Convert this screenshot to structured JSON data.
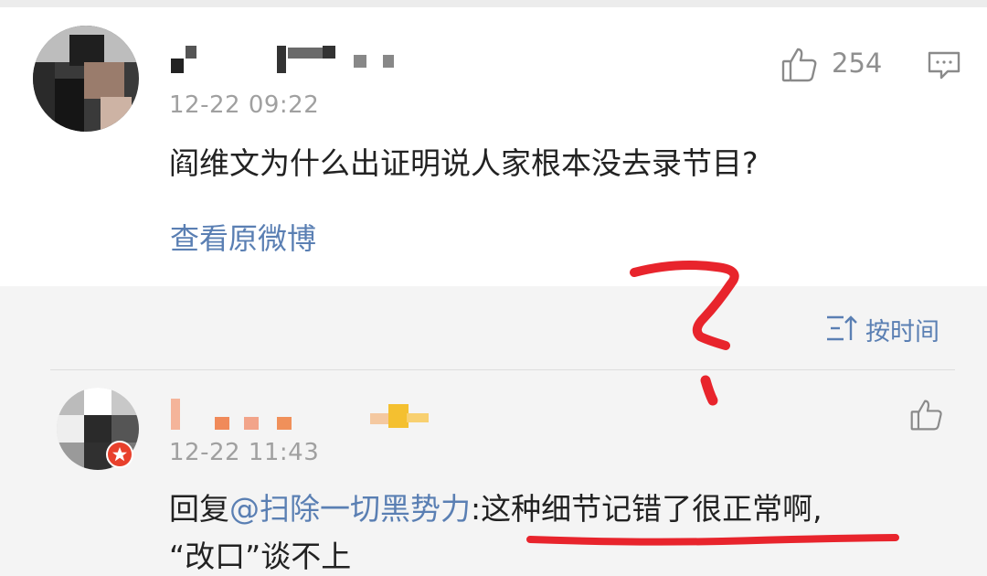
{
  "post": {
    "time": "12-22 09:22",
    "like_count": "254",
    "content": "阎维文为什么出证明说人家根本没去录节目?",
    "view_original_link": "查看原微博",
    "like_icon": "thumbs-up-icon",
    "comment_icon": "comment-bubble-icon"
  },
  "comments_header": {
    "sort_label": "按时间",
    "sort_icon": "sort-lines-icon"
  },
  "reply": {
    "time": "12-22 11:43",
    "prefix": "回复",
    "mention": "@扫除一切黑势力",
    "text_line1": ":这种细节记错了很正常啊,",
    "text_line2": "“改口”谈不上",
    "like_icon": "thumbs-up-icon"
  },
  "colors": {
    "link_blue": "#5a7fb3",
    "annotation_red": "#e8242c",
    "time_gray": "#a0a0a0"
  }
}
